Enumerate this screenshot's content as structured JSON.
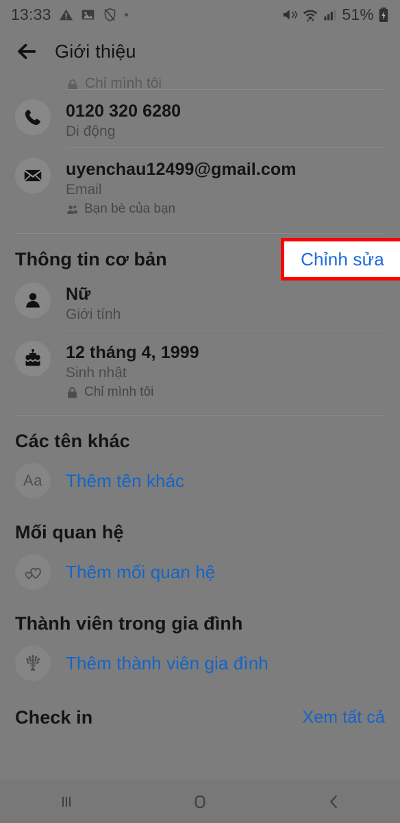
{
  "statusbar": {
    "time": "13:33",
    "battery_percent": "51%",
    "icons": [
      "warning-triangle-icon",
      "image-icon",
      "shield-off-icon",
      "dot-icon",
      "mute-icon",
      "wifi-icon",
      "signal-bars-icon",
      "battery-charging-icon"
    ]
  },
  "appbar": {
    "back_icon": "back-arrow-icon",
    "title": "Giới thiệu"
  },
  "clipped_row": {
    "privacy": "Chỉ mình tôi"
  },
  "contact": [
    {
      "icon": "phone-icon",
      "value": "0120 320 6280",
      "label": "Di động",
      "privacy": ""
    },
    {
      "icon": "envelope-icon",
      "value": "uyenchau12499@gmail.com",
      "label": "Email",
      "privacy": "Bạn bè của bạn",
      "privacy_icon": "friends-icon"
    }
  ],
  "basic_info": {
    "title": "Thông tin cơ bản",
    "edit_label": "Chỉnh sửa",
    "rows": [
      {
        "icon": "person-icon",
        "value": "Nữ",
        "label": "Giới tính",
        "privacy": ""
      },
      {
        "icon": "birthday-cake-icon",
        "value": "12 tháng 4, 1999",
        "label": "Sinh nhật",
        "privacy": "Chỉ mình tôi",
        "privacy_icon": "lock-icon"
      }
    ]
  },
  "other_names": {
    "title": "Các tên khác",
    "add_label": "Thêm tên khác",
    "icon": "aa-text-icon",
    "icon_glyph": "Aa"
  },
  "relationship": {
    "title": "Mối quan hệ",
    "add_label": "Thêm mối quan hệ",
    "icon": "hearts-icon"
  },
  "family": {
    "title": "Thành viên trong gia đình",
    "add_label": "Thêm thành viên gia đình",
    "icon": "family-tree-icon"
  },
  "checkin": {
    "title": "Check in",
    "action_label": "Xem tất cả"
  },
  "navbar": {
    "recents": "recents-icon",
    "home": "home-icon",
    "back": "back-icon"
  },
  "colors": {
    "link": "#1464c8",
    "highlight": "#ff0000",
    "scrim": "#7d7d7d"
  }
}
